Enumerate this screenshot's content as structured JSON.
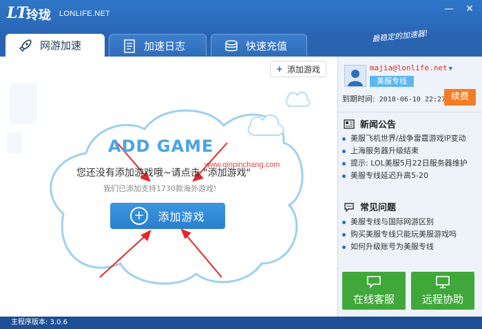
{
  "app": {
    "logo_mark": "LT",
    "logo_cn": "玲珑",
    "site": "LONLIFE.NET",
    "slogan": "最稳定的加速器!",
    "minimize": "—",
    "close": "✕"
  },
  "tabs": [
    {
      "label": "网游加速",
      "icon": "rocket-icon",
      "active": true
    },
    {
      "label": "加速日志",
      "icon": "log-icon",
      "active": false
    },
    {
      "label": "快速充值",
      "icon": "coins-icon",
      "active": false
    }
  ],
  "main": {
    "add_game_small": "添加游戏",
    "cloud_title": "ADD GAME",
    "hint": "您还没有添加游戏哦~请点击 \"添加游戏\"",
    "support": "我们已添加支持1730款海外游戏!",
    "big_button": "添加游戏",
    "watermark": "www.qinpinchang.com"
  },
  "account": {
    "email": "majia@lonlife.net",
    "plan": "美服专线",
    "expire_label": "到期时间:",
    "expire_value": "2018-06-10 22:27",
    "renew": "续费"
  },
  "news": {
    "title": "新闻公告",
    "items": [
      "美服飞机世界/战争雷霆游戏IP变动",
      "上海服务器升级结束",
      "提示: LOL美服5月22日服务器维护",
      "美服专线延迟升高5-20"
    ]
  },
  "faq": {
    "title": "常见问题",
    "items": [
      "美服专线与国际网游区别",
      "购买美服专线只能玩美服游戏吗",
      "如何升级账号为美服专线"
    ]
  },
  "actions": {
    "online_service": "在线客服",
    "remote_help": "远程协助"
  },
  "status": {
    "version": "主程序版本: 3.0.6"
  },
  "colors": {
    "title_blue": "#2a66b5",
    "accent_blue": "#2a7fcc",
    "renew_orange": "#f37d24",
    "action_green": "#40a83a",
    "email_red": "#d12b2b"
  }
}
